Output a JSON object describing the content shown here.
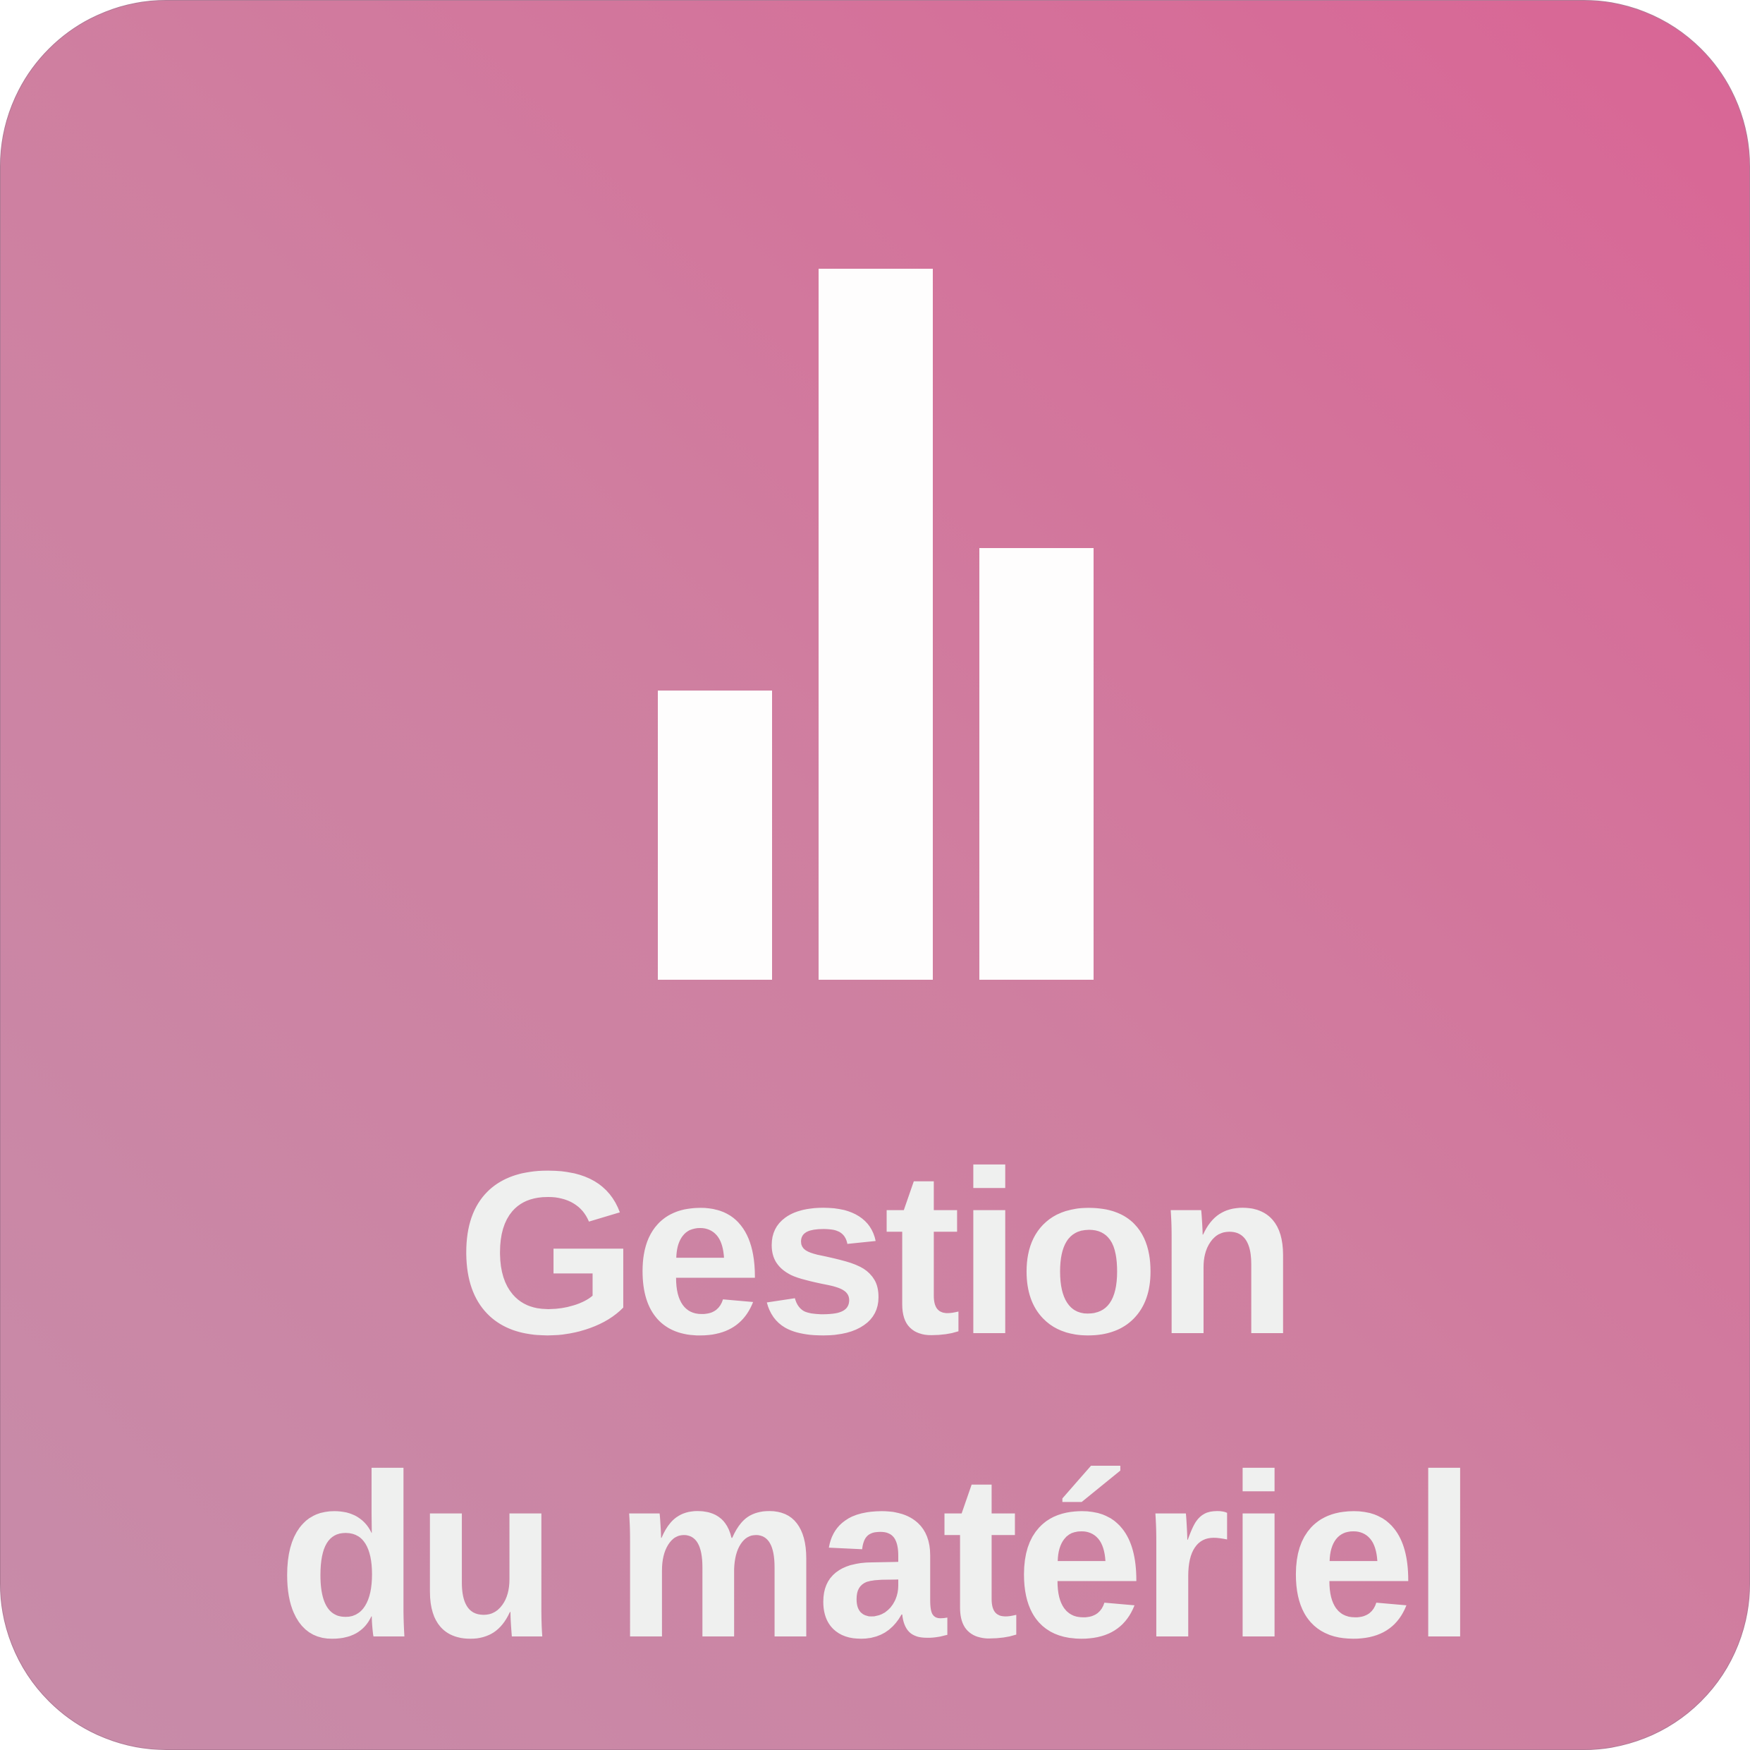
{
  "title": {
    "line1": "Gestion",
    "line2": "du matériel"
  },
  "icon": "bar-chart-icon",
  "colors": {
    "background_start": "#c78ca9",
    "background_end": "#d96595",
    "bars": "#fefdfd",
    "text": "#eff0ef"
  }
}
